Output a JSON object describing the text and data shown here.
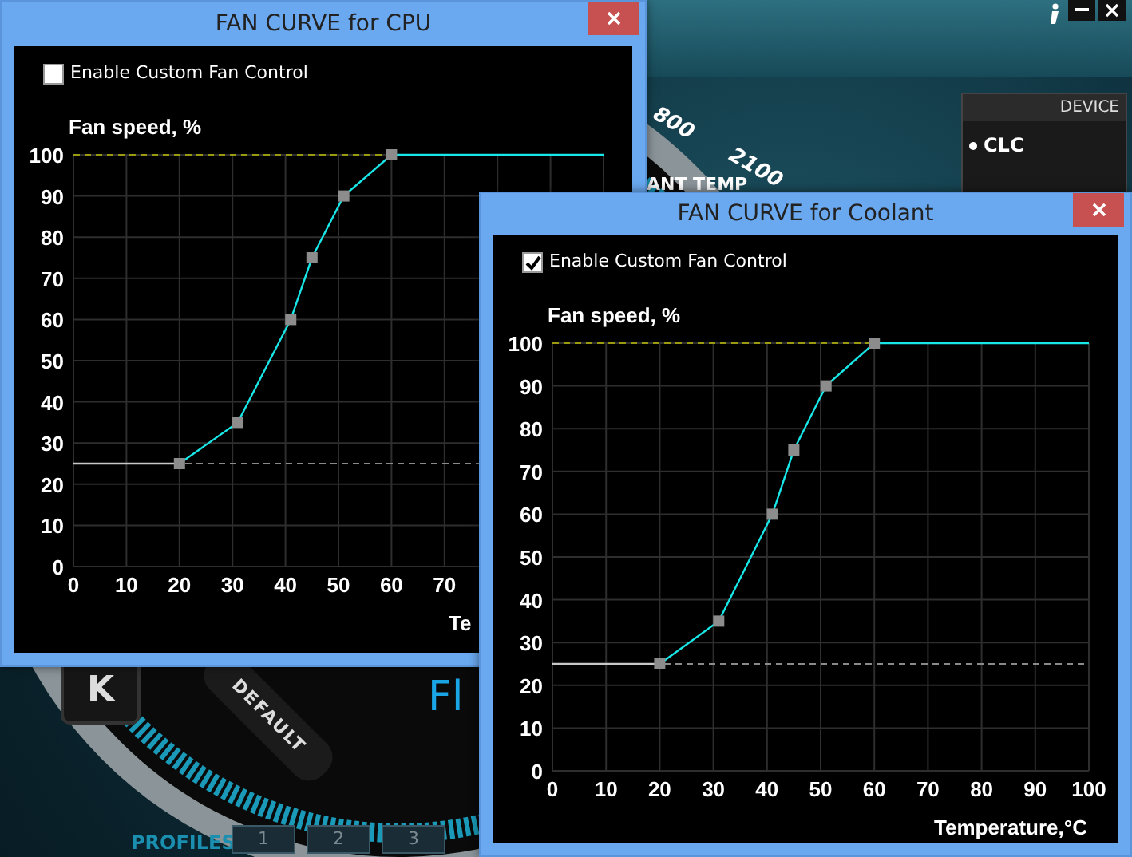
{
  "background_app": {
    "gauge_labels": [
      "800",
      "2100"
    ],
    "gauge_caption": "ANT TEMP",
    "device_panel": {
      "title": "DEVICE",
      "items": [
        {
          "label": "CLC",
          "selected": true
        }
      ]
    },
    "key_label": "K",
    "default_button": "DEFAULT",
    "fan_label": "Fl",
    "profiles": {
      "label": "PROFILES",
      "buttons": [
        "1",
        "2",
        "3"
      ]
    }
  },
  "windows": [
    {
      "title": "FAN CURVE for CPU",
      "checkbox": {
        "label": "Enable Custom Fan Control",
        "checked": false
      },
      "chart_data": {
        "type": "line",
        "ylabel": "Fan speed, %",
        "xlabel": "Te",
        "x": [
          0,
          20,
          31,
          41,
          45,
          51,
          60,
          100
        ],
        "series": [
          {
            "color": "#c8c8c8",
            "values": [
              25,
              25,
              null,
              null,
              null,
              null,
              null,
              null
            ]
          },
          {
            "color": "#19e6e6",
            "marker": "square",
            "values": [
              null,
              25,
              35,
              60,
              75,
              90,
              100,
              100
            ]
          }
        ],
        "xlim": [
          0,
          100
        ],
        "ylim": [
          0,
          100
        ],
        "xticks": [
          0,
          10,
          20,
          30,
          40,
          50,
          60,
          70
        ],
        "yticks": [
          0,
          10,
          20,
          30,
          40,
          50,
          60,
          70,
          80,
          90,
          100
        ],
        "grid": true,
        "ref_lines": [
          {
            "axis": "y",
            "value": 25,
            "color": "#8a8a8a"
          },
          {
            "axis": "y",
            "value": 100,
            "color": "#9a9a10"
          }
        ]
      }
    },
    {
      "title": "FAN CURVE for Coolant",
      "checkbox": {
        "label": "Enable Custom Fan Control",
        "checked": true
      },
      "chart_data": {
        "type": "line",
        "ylabel": "Fan speed, %",
        "xlabel": "Temperature,°C",
        "x": [
          0,
          20,
          31,
          41,
          45,
          51,
          60,
          100
        ],
        "series": [
          {
            "color": "#c8c8c8",
            "values": [
              25,
              25,
              null,
              null,
              null,
              null,
              null,
              null
            ]
          },
          {
            "color": "#19e6e6",
            "marker": "square",
            "values": [
              null,
              25,
              35,
              60,
              75,
              90,
              100,
              100
            ]
          }
        ],
        "xlim": [
          0,
          100
        ],
        "ylim": [
          0,
          100
        ],
        "xticks": [
          0,
          10,
          20,
          30,
          40,
          50,
          60,
          70,
          80,
          90,
          100
        ],
        "yticks": [
          0,
          10,
          20,
          30,
          40,
          50,
          60,
          70,
          80,
          90,
          100
        ],
        "grid": true,
        "ref_lines": [
          {
            "axis": "y",
            "value": 25,
            "color": "#8a8a8a"
          },
          {
            "axis": "y",
            "value": 100,
            "color": "#9a9a10"
          }
        ]
      }
    }
  ]
}
